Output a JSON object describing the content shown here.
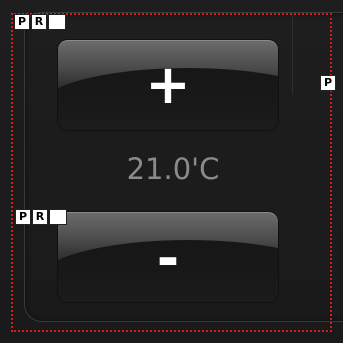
{
  "thermostat": {
    "increase_label": "+",
    "decrease_label": "-",
    "temperature": "21.0'C"
  },
  "tags": {
    "top": [
      "P",
      "R",
      ""
    ],
    "middle": [
      "P",
      "R",
      ""
    ],
    "right": [
      "P"
    ]
  },
  "colors": {
    "selection_border": "#d21b1b",
    "background": "#1b1b1b",
    "temperature_text": "#8b8b8b"
  }
}
